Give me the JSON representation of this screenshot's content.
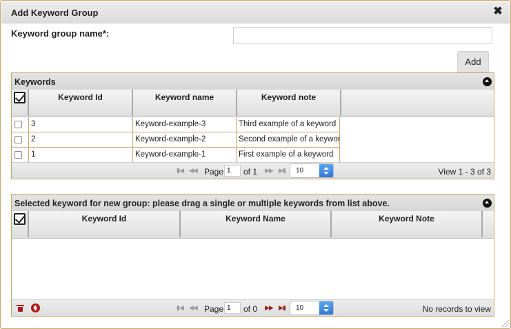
{
  "dialog": {
    "title": "Add Keyword Group",
    "close_symbol": "✖"
  },
  "form": {
    "name_label": "Keyword group name*:",
    "name_value": "",
    "add_label": "Add"
  },
  "keywords_grid": {
    "caption": "Keywords",
    "columns": [
      "Keyword Id",
      "Keyword name",
      "Keyword note"
    ],
    "rows": [
      {
        "id": "3",
        "name": "Keyword-example-3",
        "note": "Third example of a keyword"
      },
      {
        "id": "2",
        "name": "Keyword-example-2",
        "note": "Second example of a keyword"
      },
      {
        "id": "1",
        "name": "Keyword-example-1",
        "note": "First example of a keyword"
      }
    ],
    "pager": {
      "page_label": "Page",
      "page_value": "1",
      "of_label": "of 1",
      "rows_per_page": "10",
      "view_text": "View 1 - 3 of 3"
    }
  },
  "selected_grid": {
    "caption": "Selected keyword for new group: please drag a single or multiple keywords from list above.",
    "columns": [
      "Keyword Id",
      "Keyword Name",
      "Keyword Note"
    ],
    "rows": [],
    "pager": {
      "page_label": "Page",
      "page_value": "1",
      "of_label": "of 0",
      "rows_per_page": "10",
      "view_text": "No records to view"
    }
  },
  "colors": {
    "border_accent": "#c9a86a",
    "action_red": "#b01818",
    "select_blue": "#2f78d8"
  },
  "icons": {
    "first_page": "first-page-icon",
    "prev_page": "prev-page-icon",
    "next_page": "next-page-icon",
    "last_page": "last-page-icon",
    "delete": "trash-icon",
    "move_up": "arrow-up-circle-icon",
    "collapse": "collapse-icon"
  }
}
